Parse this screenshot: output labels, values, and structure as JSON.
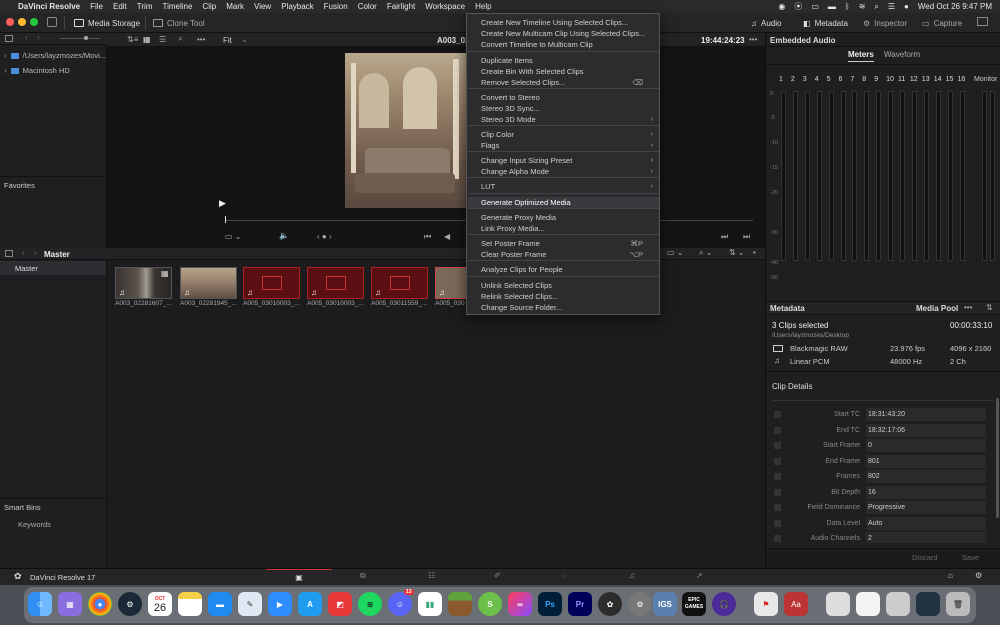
{
  "menubar": {
    "app": "DaVinci Resolve",
    "items": [
      "File",
      "Edit",
      "Trim",
      "Timeline",
      "Clip",
      "Mark",
      "View",
      "Playback",
      "Fusion",
      "Color",
      "Fairlight",
      "Workspace",
      "Help"
    ],
    "datetime": "Wed Oct 26  9:47 PM"
  },
  "toolbar": {
    "media_storage": "Media Storage",
    "clone_tool": "Clone Tool",
    "audio": "Audio",
    "metadata": "Metadata",
    "inspector": "Inspector",
    "capture": "Capture"
  },
  "storage": {
    "items": [
      "/Users/layzmozes/Movi...",
      "Macintosh HD"
    ],
    "favorites": "Favorites"
  },
  "viewer": {
    "fit": "Fit",
    "clip_name": "A003_02",
    "timecode": "19:44:24:23"
  },
  "audio_panel": {
    "title": "Embedded Audio",
    "tabs": [
      "Meters",
      "Waveform"
    ],
    "channels": [
      "1",
      "2",
      "3",
      "4",
      "5",
      "6",
      "7",
      "8",
      "9",
      "10",
      "11",
      "12",
      "13",
      "14",
      "15",
      "16"
    ],
    "monitor": "Monitor",
    "scale": [
      "0",
      "-5",
      "-10",
      "-15",
      "-20",
      "-30",
      "-40",
      "-50"
    ]
  },
  "media_pool": {
    "bin": "Master",
    "bins": [
      "Master"
    ],
    "smart_bins": "Smart Bins",
    "keywords": "Keywords",
    "clips": [
      "A003_02281607_...",
      "A003_02281945_...",
      "A005_03010003_...",
      "A005_03010003_...",
      "A005_03011559_...",
      "A005_0301"
    ]
  },
  "metadata": {
    "title": "Metadata",
    "tab": "Media Pool",
    "selected": "3 Clips selected",
    "duration": "00:00:33:10",
    "path": "/Users/layzmozes/Desktop",
    "video_codec": "Blackmagic RAW",
    "fps": "23.976 fps",
    "resolution": "4096 x 2160",
    "audio_codec": "Linear PCM",
    "sample_rate": "48000 Hz",
    "channels": "2 Ch",
    "clip_details": "Clip Details",
    "fields": [
      {
        "label": "Start TC",
        "value": "18:31:43:20"
      },
      {
        "label": "End TC",
        "value": "18:32:17:06"
      },
      {
        "label": "Start Frame",
        "value": "0"
      },
      {
        "label": "End Frame",
        "value": "801"
      },
      {
        "label": "Frames",
        "value": "802"
      },
      {
        "label": "Bit Depth",
        "value": "16"
      },
      {
        "label": "Field Dominance",
        "value": "Progressive"
      },
      {
        "label": "Data Level",
        "value": "Auto"
      },
      {
        "label": "Audio Channels",
        "value": "2"
      }
    ],
    "discard": "Discard",
    "save": "Save"
  },
  "context_menu": [
    {
      "label": "Create New Timeline Using Selected Clips..."
    },
    {
      "label": "Create New Multicam Clip Using Selected Clips..."
    },
    {
      "label": "Convert Timeline to Multicam Clip"
    },
    {
      "label": "Duplicate Items"
    },
    {
      "label": "Create Bin With Selected Clips"
    },
    {
      "label": "Remove Selected Clips...",
      "key": "⌫"
    },
    {
      "label": "Convert to Stereo"
    },
    {
      "label": "Stereo 3D Sync..."
    },
    {
      "label": "Stereo 3D Mode",
      "arrow": "›"
    },
    {
      "label": "Clip Color",
      "arrow": "›"
    },
    {
      "label": "Flags",
      "arrow": "›"
    },
    {
      "label": "Change Input Sizing Preset",
      "arrow": "›"
    },
    {
      "label": "Change Alpha Mode",
      "arrow": "›"
    },
    {
      "label": "LUT",
      "arrow": "›"
    },
    {
      "label": "Generate Optimized Media"
    },
    {
      "label": "Generate Proxy Media"
    },
    {
      "label": "Link Proxy Media..."
    },
    {
      "label": "Set Poster Frame",
      "key": "⌘P"
    },
    {
      "label": "Clear Poster Frame",
      "key": "⌥P"
    },
    {
      "label": "Analyze Clips for People"
    },
    {
      "label": "Unlink Selected Clips"
    },
    {
      "label": "Relink Selected Clips..."
    },
    {
      "label": "Change Source Folder..."
    }
  ],
  "pagebar": {
    "app_name": "DaVinci Resolve 17"
  },
  "dock": {
    "calendar_month": "OCT",
    "calendar_day": "26",
    "discord_badge": "13",
    "epic": "EPIC GAMES",
    "adobe_ps": "Ps",
    "adobe_pr": "Pr",
    "aa": "Aa"
  }
}
